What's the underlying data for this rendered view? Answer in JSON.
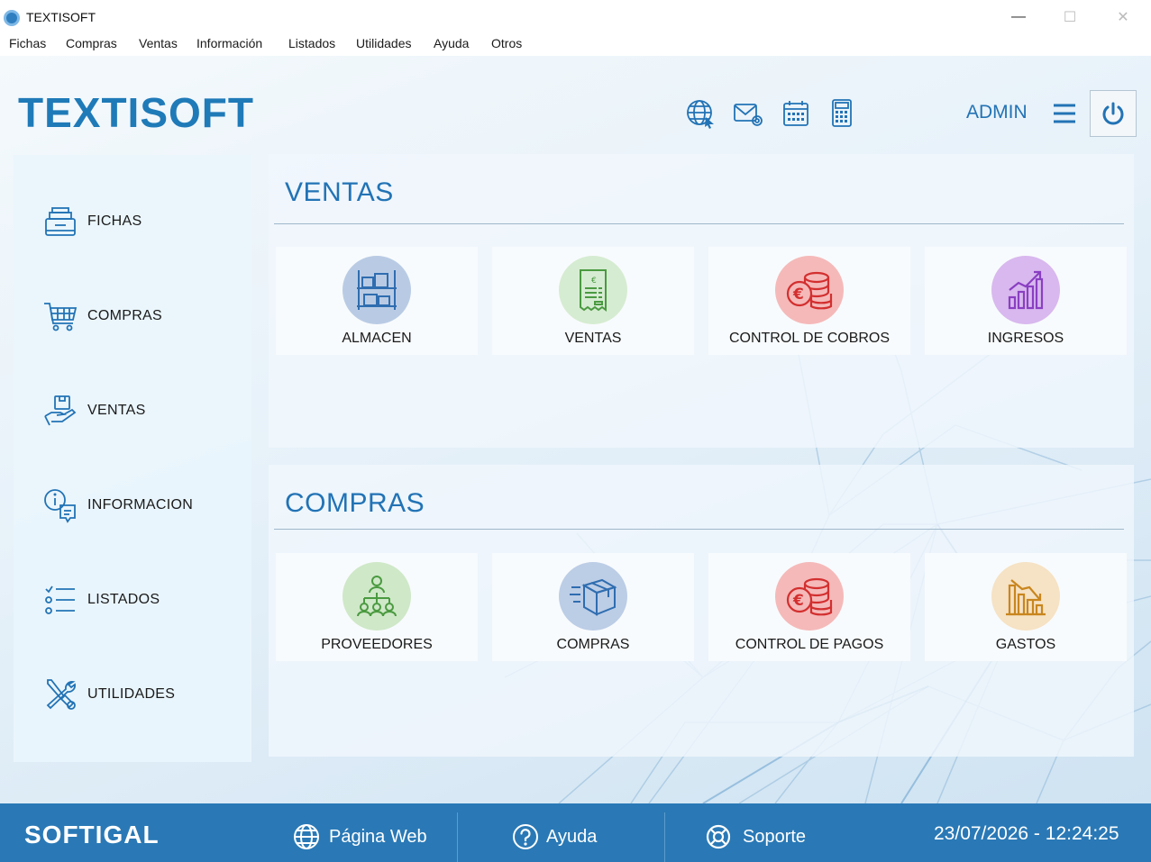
{
  "window": {
    "title": "TEXTISOFT",
    "minimize": "—",
    "maximize": "☐",
    "close": "✕"
  },
  "menu": {
    "items": [
      "Fichas",
      "Compras",
      "Ventas",
      "Información",
      "Listados",
      "Utilidades",
      "Ayuda",
      "Otros"
    ]
  },
  "header": {
    "logo": "TEXTISOFT",
    "user": "ADMIN",
    "icons": [
      "globe-icon",
      "mail-icon",
      "calendar-icon",
      "calculator-icon",
      "menu-icon",
      "power-icon"
    ]
  },
  "sidebar": {
    "items": [
      {
        "label": "FICHAS",
        "icon": "file-box-icon"
      },
      {
        "label": "COMPRAS",
        "icon": "shopping-cart-icon"
      },
      {
        "label": "VENTAS",
        "icon": "hand-package-icon"
      },
      {
        "label": "INFORMACION",
        "icon": "info-chat-icon"
      },
      {
        "label": "LISTADOS",
        "icon": "list-icon"
      },
      {
        "label": "UTILIDADES",
        "icon": "tools-icon"
      }
    ]
  },
  "ventas_panel": {
    "title": "VENTAS",
    "tiles": [
      {
        "label": "ALMACEN",
        "icon": "warehouse-shelves-icon",
        "color": "#b9cbe4"
      },
      {
        "label": "VENTAS",
        "icon": "receipt-icon",
        "color": "#d6ecd2"
      },
      {
        "label": "CONTROL DE COBROS",
        "icon": "euro-coins-icon",
        "color": "#f5b9b9"
      },
      {
        "label": "INGRESOS",
        "icon": "bar-chart-up-icon",
        "color": "#d8b8ee"
      }
    ]
  },
  "compras_panel": {
    "title": "COMPRAS",
    "tiles": [
      {
        "label": "PROVEEDORES",
        "icon": "network-people-icon",
        "color": "#cfe8c8"
      },
      {
        "label": "COMPRAS",
        "icon": "package-box-icon",
        "color": "#bccde6"
      },
      {
        "label": "CONTROL DE PAGOS",
        "icon": "euro-coins-icon",
        "color": "#f5b9b9"
      },
      {
        "label": "GASTOS",
        "icon": "bar-chart-down-icon",
        "color": "#f6e2c4"
      }
    ]
  },
  "footer": {
    "logo": "SOFTIGAL",
    "web": "Página Web",
    "help": "Ayuda",
    "support": "Soporte",
    "datetime": "23/07/2026  -  12:24:25"
  },
  "colors": {
    "brand": "#2273b5",
    "footer": "#2a79b6"
  }
}
